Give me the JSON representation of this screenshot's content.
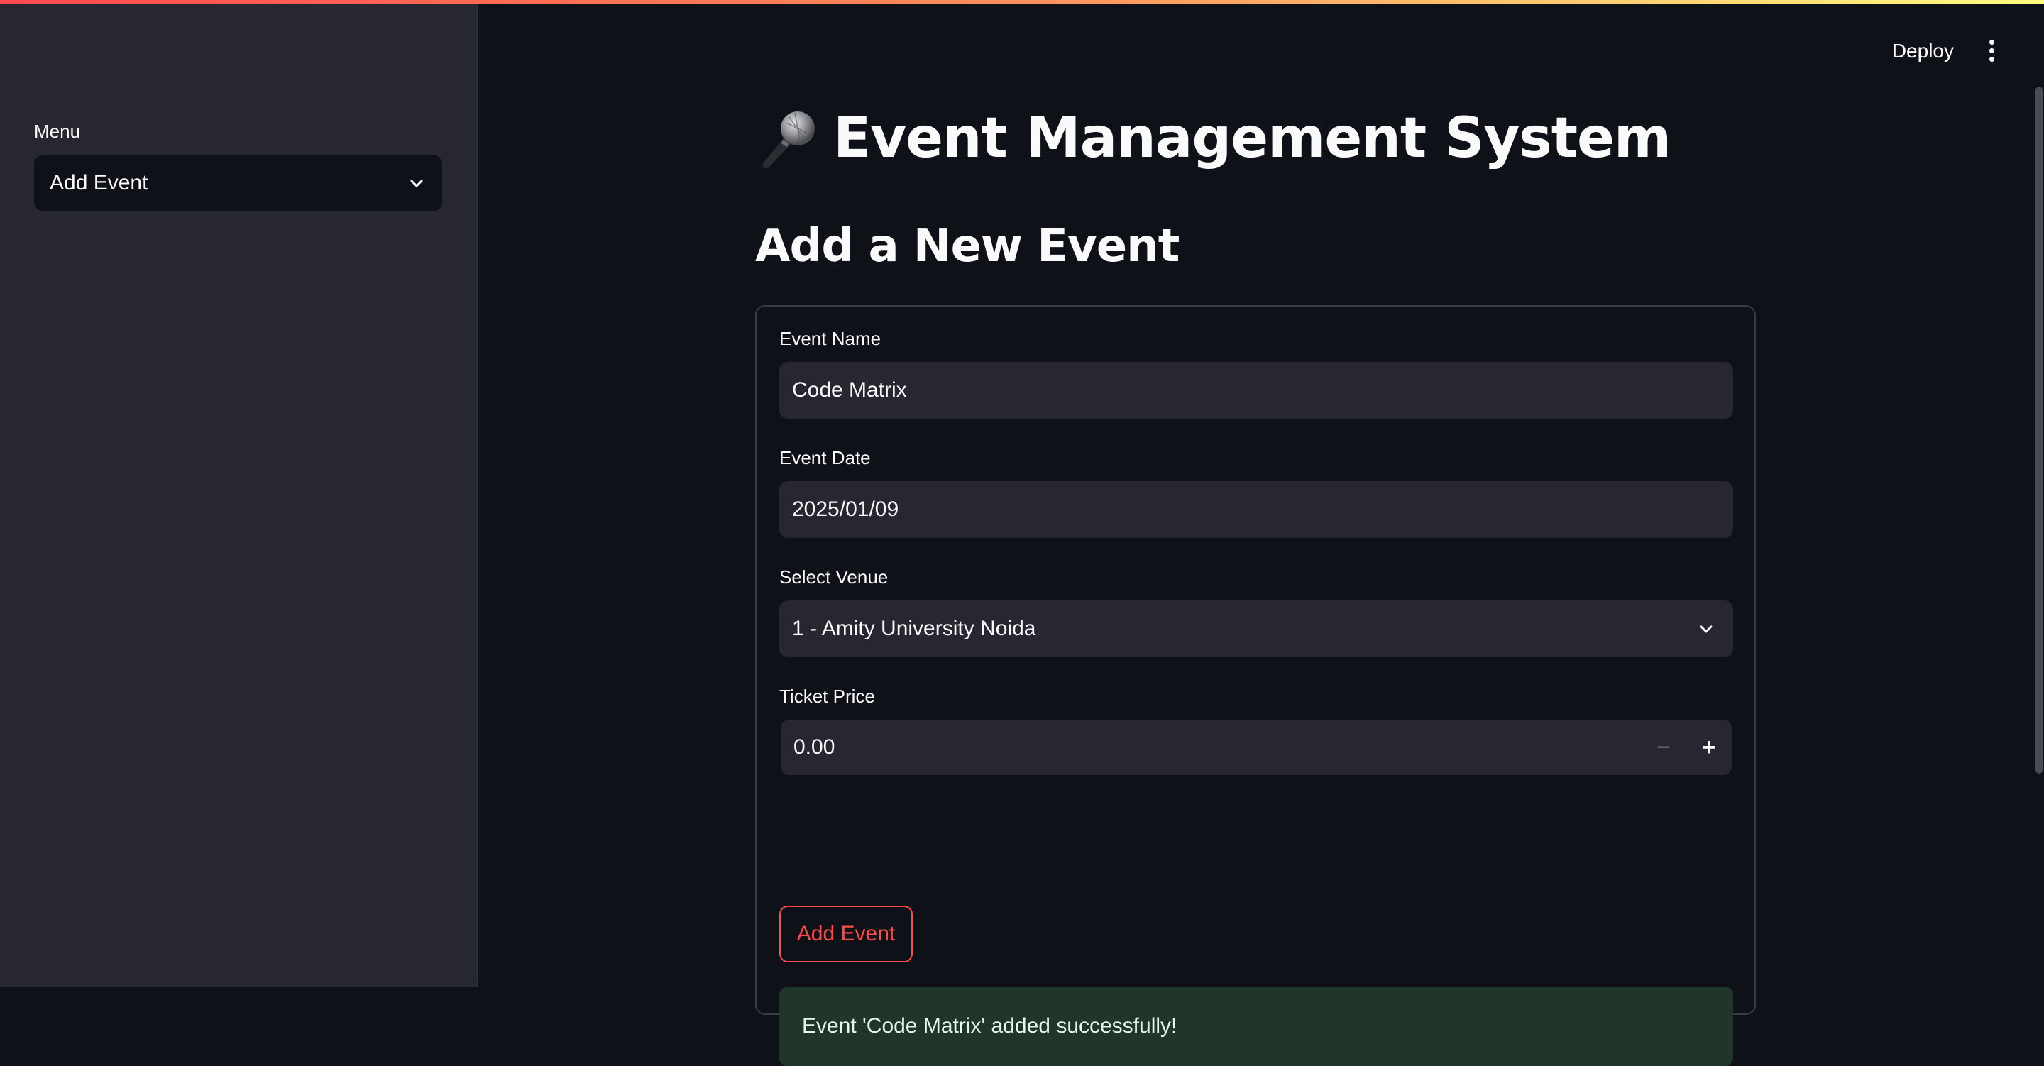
{
  "sidebar": {
    "menu_label": "Menu",
    "menu_value": "Add Event"
  },
  "header": {
    "deploy_label": "Deploy",
    "more_icon": "kebab-menu-icon"
  },
  "page": {
    "title": "Event Management System",
    "title_icon": "microphone-icon",
    "section_title": "Add a New Event"
  },
  "form": {
    "event_name_label": "Event Name",
    "event_name_value": "Code Matrix",
    "event_date_label": "Event Date",
    "event_date_value": "2025/01/09",
    "venue_label": "Select Venue",
    "venue_value": "1 - Amity University Noida",
    "ticket_price_label": "Ticket Price",
    "ticket_price_value": "0.00",
    "minus_symbol": "−",
    "plus_symbol": "+",
    "submit_label": "Add Event"
  },
  "alert": {
    "message": "Event 'Code Matrix' added successfully!"
  },
  "colors": {
    "accent": "#ff4b4b",
    "background": "#0e1117",
    "sidebar": "#262730",
    "success_bg": "#21362b"
  }
}
